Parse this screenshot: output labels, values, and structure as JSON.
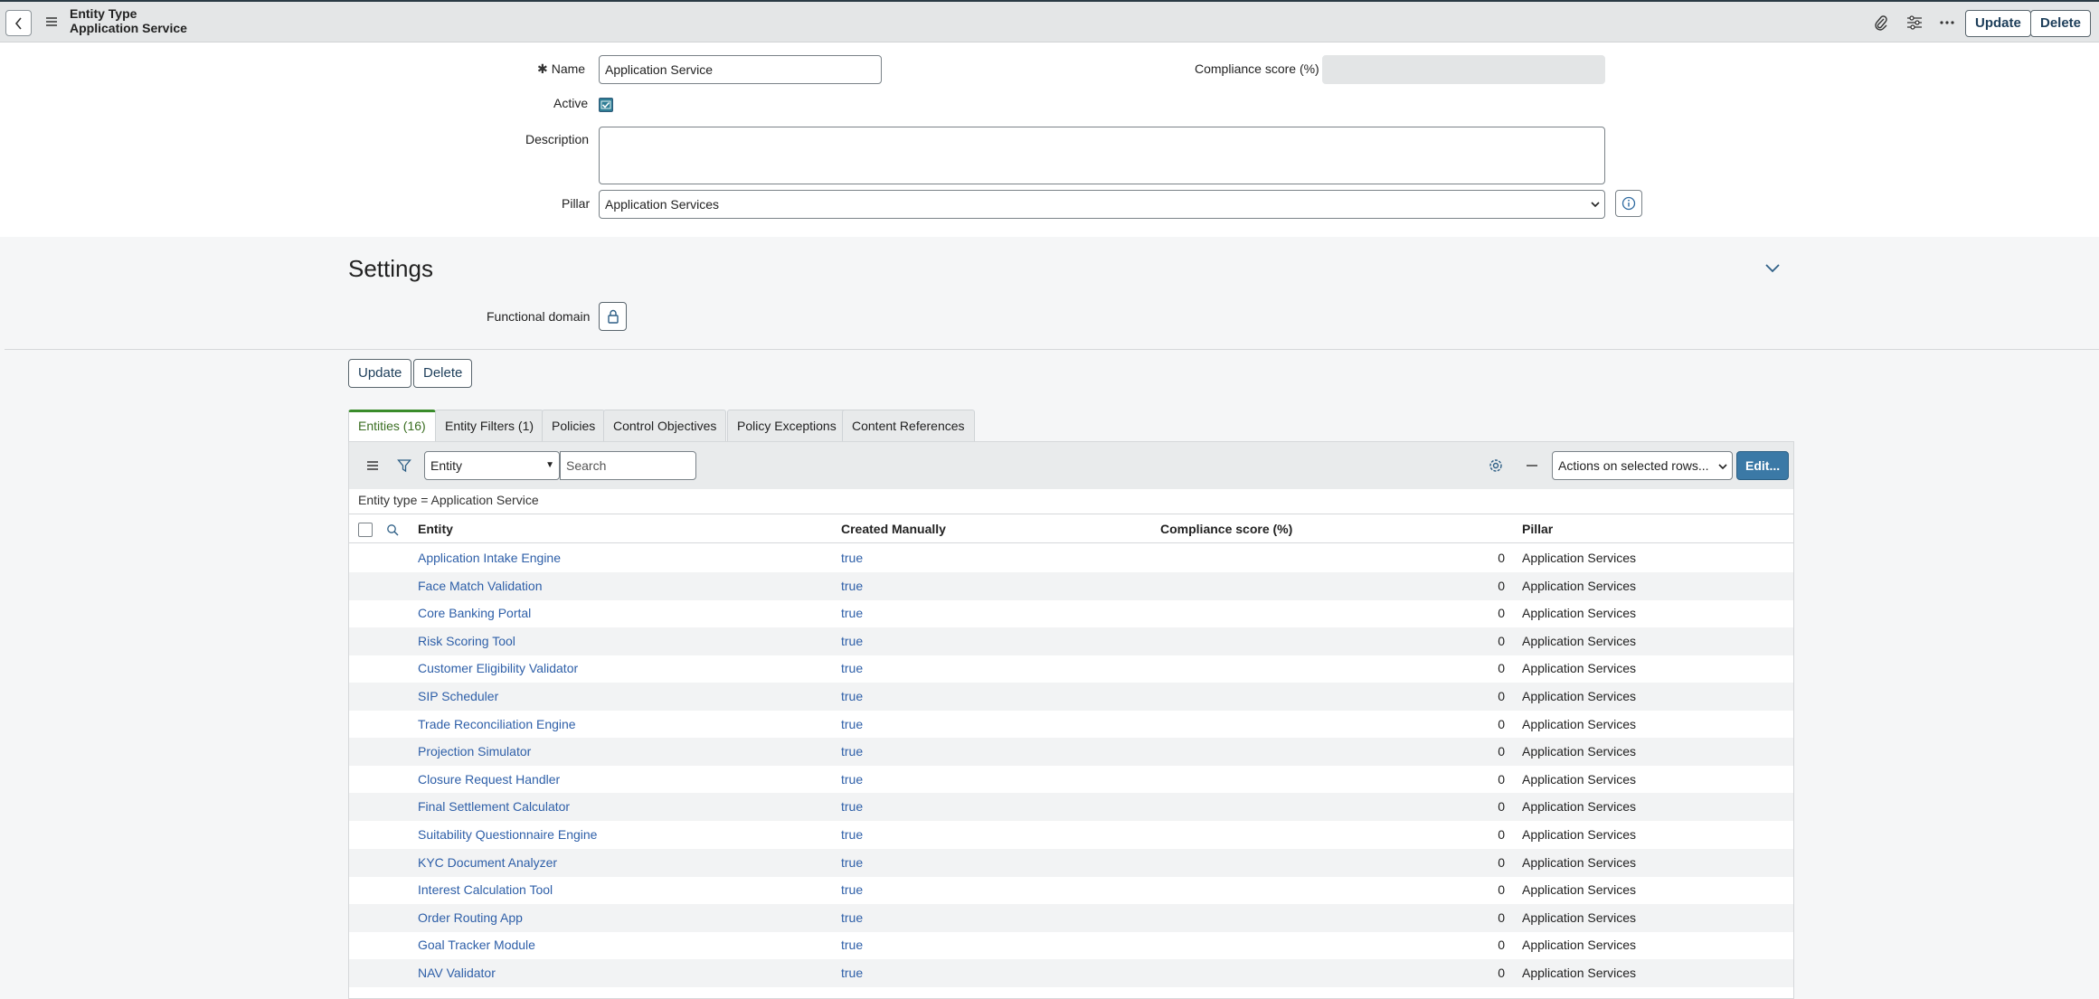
{
  "header": {
    "record_type": "Entity Type",
    "record_name": "Application Service",
    "update_label": "Update",
    "delete_label": "Delete"
  },
  "form": {
    "name_label": "Name",
    "name_value": "Application Service",
    "active_label": "Active",
    "active_checked": true,
    "description_label": "Description",
    "description_value": "",
    "pillar_label": "Pillar",
    "pillar_value": "Application Services",
    "compliance_label": "Compliance score (%)",
    "compliance_value": ""
  },
  "settings": {
    "title": "Settings",
    "functional_domain_label": "Functional domain"
  },
  "form_actions": {
    "update_label": "Update",
    "delete_label": "Delete"
  },
  "tabs": [
    {
      "label": "Entities (16)",
      "active": true
    },
    {
      "label": "Entity Filters (1)",
      "active": false
    },
    {
      "label": "Policies",
      "active": false
    },
    {
      "label": "Control Objectives",
      "active": false
    },
    {
      "label": "Policy Exceptions",
      "active": false
    },
    {
      "label": "Content References",
      "active": false
    }
  ],
  "list": {
    "search_field": "Entity",
    "search_placeholder": "Search",
    "actions_label": "Actions on selected rows...",
    "edit_label": "Edit...",
    "filter_breadcrumb": "Entity type = Application Service",
    "columns": [
      "Entity",
      "Created Manually",
      "Compliance score (%)",
      "Pillar"
    ],
    "rows": [
      {
        "entity": "Application Intake Engine",
        "created": "true",
        "score": "0",
        "pillar": "Application Services"
      },
      {
        "entity": "Face Match Validation",
        "created": "true",
        "score": "0",
        "pillar": "Application Services"
      },
      {
        "entity": "Core Banking Portal",
        "created": "true",
        "score": "0",
        "pillar": "Application Services"
      },
      {
        "entity": "Risk Scoring Tool",
        "created": "true",
        "score": "0",
        "pillar": "Application Services"
      },
      {
        "entity": "Customer Eligibility Validator",
        "created": "true",
        "score": "0",
        "pillar": "Application Services"
      },
      {
        "entity": "SIP Scheduler",
        "created": "true",
        "score": "0",
        "pillar": "Application Services"
      },
      {
        "entity": "Trade Reconciliation Engine",
        "created": "true",
        "score": "0",
        "pillar": "Application Services"
      },
      {
        "entity": "Projection Simulator",
        "created": "true",
        "score": "0",
        "pillar": "Application Services"
      },
      {
        "entity": "Closure Request Handler",
        "created": "true",
        "score": "0",
        "pillar": "Application Services"
      },
      {
        "entity": "Final Settlement Calculator",
        "created": "true",
        "score": "0",
        "pillar": "Application Services"
      },
      {
        "entity": "Suitability Questionnaire Engine",
        "created": "true",
        "score": "0",
        "pillar": "Application Services"
      },
      {
        "entity": "KYC Document Analyzer",
        "created": "true",
        "score": "0",
        "pillar": "Application Services"
      },
      {
        "entity": "Interest Calculation Tool",
        "created": "true",
        "score": "0",
        "pillar": "Application Services"
      },
      {
        "entity": "Order Routing App",
        "created": "true",
        "score": "0",
        "pillar": "Application Services"
      },
      {
        "entity": "Goal Tracker Module",
        "created": "true",
        "score": "0",
        "pillar": "Application Services"
      },
      {
        "entity": "NAV Validator",
        "created": "true",
        "score": "0",
        "pillar": "Application Services"
      }
    ]
  },
  "icons": {
    "back": "chevron-left-icon",
    "menu": "hamburger-icon",
    "attachment": "paperclip-icon",
    "personalize": "sliders-icon",
    "more": "ellipsis-icon",
    "info": "info-icon",
    "lock": "lock-icon",
    "collapse": "chevron-down-icon",
    "filter": "funnel-icon",
    "settings": "gear-icon"
  },
  "colors": {
    "link": "#2e5fa8",
    "active_tab": "#3a8c2b",
    "primary_button": "#3b79a6"
  }
}
